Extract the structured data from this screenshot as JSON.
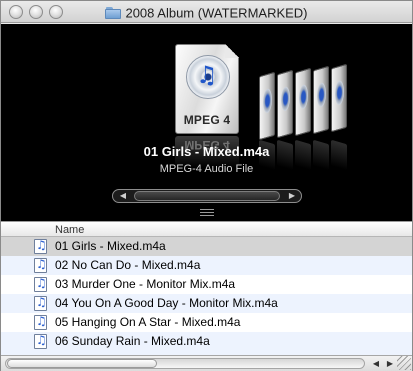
{
  "window": {
    "title": "2008 Album (WATERMARKED)"
  },
  "coverflow": {
    "selected_name": "01 Girls - Mixed.m4a",
    "selected_type": "MPEG-4 Audio File",
    "icon_label": "MPEG 4",
    "icon_label_reflection": "MPEG 4"
  },
  "list": {
    "column_name": "Name",
    "files": [
      {
        "name": "01 Girls - Mixed.m4a",
        "selected": true
      },
      {
        "name": "02 No Can Do - Mixed.m4a",
        "selected": false
      },
      {
        "name": "03 Murder One - Monitor Mix.m4a",
        "selected": false
      },
      {
        "name": "04 You On A Good Day - Monitor Mix.m4a",
        "selected": false
      },
      {
        "name": "05 Hanging On A Star - Mixed.m4a",
        "selected": false
      },
      {
        "name": "06 Sunday Rain - Mixed.m4a",
        "selected": false
      }
    ]
  },
  "colors": {
    "selection": "#d4d4d4",
    "stripe": "#edf3fe",
    "coverflow_bg": "#000000"
  }
}
